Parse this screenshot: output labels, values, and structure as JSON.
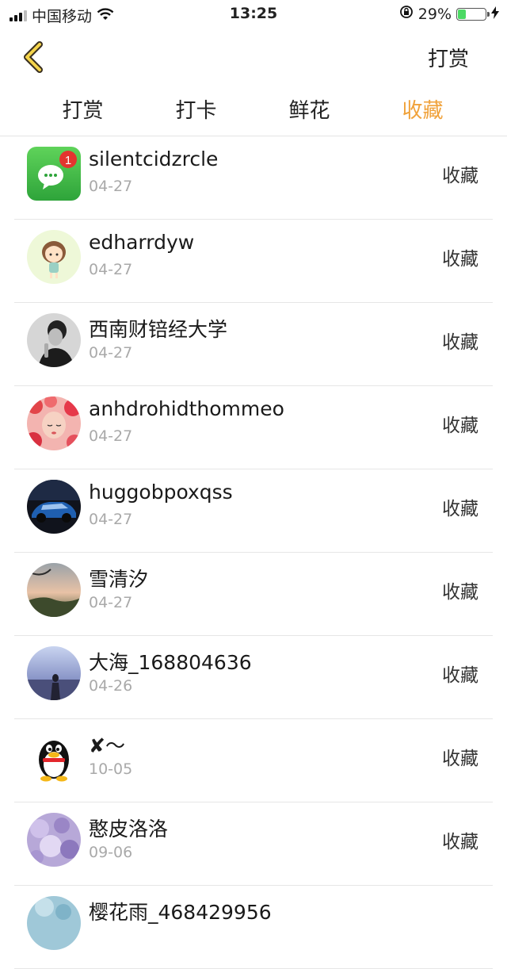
{
  "status_bar": {
    "carrier": "中国移动",
    "time": "13:25",
    "battery": "29%",
    "battery_level": 0.29
  },
  "nav": {
    "back_icon": "chevron-left-icon",
    "action_label": "打赏"
  },
  "tabs": [
    {
      "label": "打赏",
      "active": false
    },
    {
      "label": "打卡",
      "active": false
    },
    {
      "label": "鲜花",
      "active": false
    },
    {
      "label": "收藏",
      "active": true
    }
  ],
  "accent_color": "#f0a23b",
  "list": [
    {
      "name": "silentcidzrcle",
      "date": "04-27",
      "action": "收藏"
    },
    {
      "name": "edharrdyw",
      "date": "04-27",
      "action": "收藏"
    },
    {
      "name": "西南财锫经大学",
      "date": "04-27",
      "action": "收藏"
    },
    {
      "name": "anhdrohidthommeo",
      "date": "04-27",
      "action": "收藏"
    },
    {
      "name": "huggobpoxqss",
      "date": "04-27",
      "action": "收藏"
    },
    {
      "name": "雪清汐",
      "date": "04-27",
      "action": "收藏"
    },
    {
      "name": "大海_168804636",
      "date": "04-26",
      "action": "收藏"
    },
    {
      "name": "✘～",
      "date": "10-05",
      "action": "收藏"
    },
    {
      "name": "憨皮洛洛",
      "date": "09-06",
      "action": "收藏"
    },
    {
      "name": "樱花雨_468429956",
      "date": "",
      "action": ""
    }
  ]
}
